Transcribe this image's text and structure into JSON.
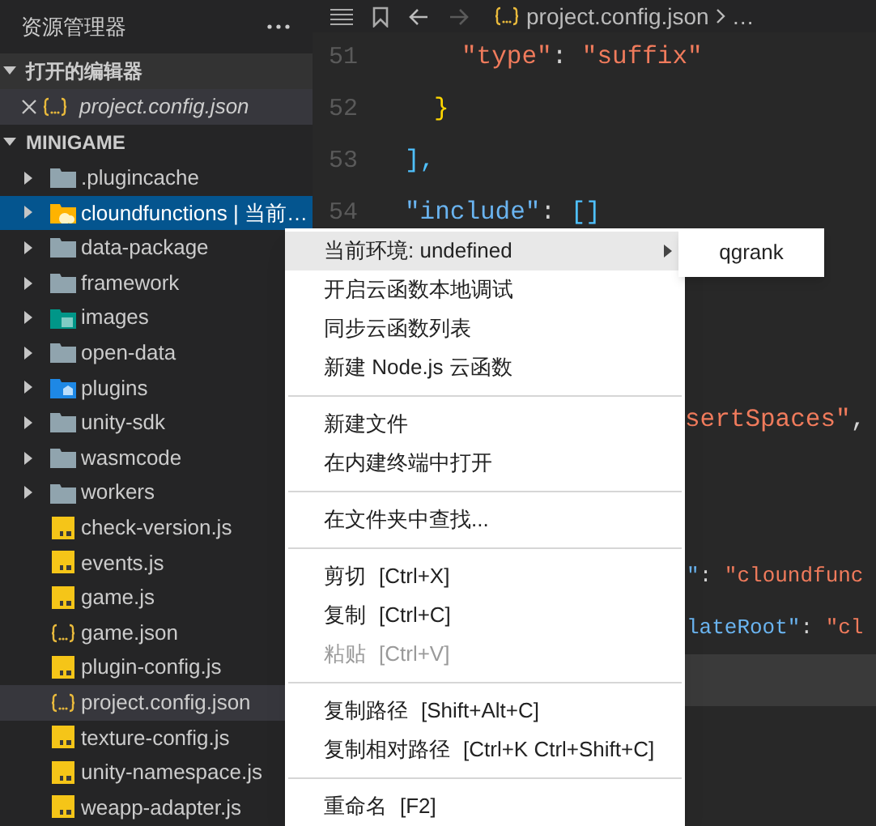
{
  "sidebar": {
    "title": "资源管理器",
    "open_editors": {
      "title": "打开的编辑器",
      "expanded": true,
      "items": [
        {
          "name": "project.config.json",
          "kind": "json",
          "active": true
        }
      ]
    },
    "project": {
      "title": "MINIGAME",
      "expanded": true,
      "items": [
        {
          "name": ".plugincache",
          "kind": "folder",
          "selected": false,
          "active": false
        },
        {
          "name": "cloundfunctions | 当前…",
          "kind": "folder-cloud",
          "selected": true,
          "active": false
        },
        {
          "name": "data-package",
          "kind": "folder",
          "selected": false,
          "active": false
        },
        {
          "name": "framework",
          "kind": "folder",
          "selected": false,
          "active": false
        },
        {
          "name": "images",
          "kind": "folder-images",
          "selected": false,
          "active": false
        },
        {
          "name": "open-data",
          "kind": "folder",
          "selected": false,
          "active": false
        },
        {
          "name": "plugins",
          "kind": "folder-plugin",
          "selected": false,
          "active": false
        },
        {
          "name": "unity-sdk",
          "kind": "folder",
          "selected": false,
          "active": false
        },
        {
          "name": "wasmcode",
          "kind": "folder",
          "selected": false,
          "active": false
        },
        {
          "name": "workers",
          "kind": "folder",
          "selected": false,
          "active": false
        },
        {
          "name": "check-version.js",
          "kind": "js",
          "selected": false,
          "active": false
        },
        {
          "name": "events.js",
          "kind": "js",
          "selected": false,
          "active": false
        },
        {
          "name": "game.js",
          "kind": "js",
          "selected": false,
          "active": false
        },
        {
          "name": "game.json",
          "kind": "json",
          "selected": false,
          "active": false
        },
        {
          "name": "plugin-config.js",
          "kind": "js",
          "selected": false,
          "active": false
        },
        {
          "name": "project.config.json",
          "kind": "json",
          "selected": false,
          "active": true
        },
        {
          "name": "texture-config.js",
          "kind": "js",
          "selected": false,
          "active": false
        },
        {
          "name": "unity-namespace.js",
          "kind": "js",
          "selected": false,
          "active": false
        },
        {
          "name": "weapp-adapter.js",
          "kind": "js",
          "selected": false,
          "active": false
        }
      ]
    }
  },
  "editor": {
    "breadcrumb": [
      "project.config.json",
      "…"
    ],
    "lines": [
      {
        "number": "51",
        "current": false,
        "tokens": [
          {
            "kind": "string",
            "text": "\"type\""
          },
          {
            "kind": "punct",
            "text": ": "
          },
          {
            "kind": "string",
            "text": "\"suffix\""
          }
        ]
      },
      {
        "number": "52",
        "current": false,
        "tokens": [
          {
            "kind": "brace",
            "text": "}"
          }
        ]
      },
      {
        "number": "53",
        "current": false,
        "tokens": [
          {
            "kind": "bracket",
            "text": "],"
          }
        ]
      },
      {
        "number": "54",
        "current": false,
        "tokens": [
          {
            "kind": "key",
            "text": "\"include\""
          },
          {
            "kind": "punct",
            "text": ": "
          },
          {
            "kind": "bracket",
            "text": "[]"
          }
        ]
      },
      {
        "current": false
      },
      {
        "current": false
      },
      {
        "current": false
      },
      {
        "current": false,
        "tokens": [
          {
            "kind": "string",
            "text": "sertSpaces\""
          },
          {
            "kind": "punct",
            "text": ","
          }
        ]
      },
      {
        "current": false
      },
      {
        "current": false
      },
      {
        "current": false,
        "tokens": [
          {
            "kind": "key",
            "text": "\""
          },
          {
            "kind": "punct",
            "text": ": "
          },
          {
            "kind": "string",
            "text": "\"cloundfunc"
          }
        ]
      },
      {
        "current": false,
        "tokens": [
          {
            "kind": "key",
            "text": "lateRoot\""
          },
          {
            "kind": "punct",
            "text": ": "
          },
          {
            "kind": "string",
            "text": "\"cl"
          }
        ]
      },
      {
        "current": true
      }
    ]
  },
  "context_menu": {
    "items": [
      {
        "kind": "item",
        "label": "当前环境: undefined",
        "highlighted": true,
        "disabled": false,
        "submenu": true
      },
      {
        "kind": "item",
        "label": "开启云函数本地调试",
        "highlighted": false,
        "disabled": false,
        "submenu": false
      },
      {
        "kind": "item",
        "label": "同步云函数列表",
        "highlighted": false,
        "disabled": false,
        "submenu": false
      },
      {
        "kind": "item",
        "label": "新建 Node.js 云函数",
        "highlighted": false,
        "disabled": false,
        "submenu": false
      },
      {
        "kind": "separator"
      },
      {
        "kind": "item",
        "label": "新建文件",
        "highlighted": false,
        "disabled": false,
        "submenu": false
      },
      {
        "kind": "item",
        "label": "在内建终端中打开",
        "highlighted": false,
        "disabled": false,
        "submenu": false
      },
      {
        "kind": "separator"
      },
      {
        "kind": "item",
        "label": "在文件夹中查找...",
        "highlighted": false,
        "disabled": false,
        "submenu": false
      },
      {
        "kind": "separator"
      },
      {
        "kind": "item",
        "label": "剪切",
        "shortcut": "[Ctrl+X]",
        "highlighted": false,
        "disabled": false,
        "submenu": false
      },
      {
        "kind": "item",
        "label": "复制",
        "shortcut": "[Ctrl+C]",
        "highlighted": false,
        "disabled": false,
        "submenu": false
      },
      {
        "kind": "item",
        "label": "粘贴",
        "shortcut": "[Ctrl+V]",
        "highlighted": false,
        "disabled": true,
        "submenu": false
      },
      {
        "kind": "separator"
      },
      {
        "kind": "item",
        "label": "复制路径",
        "shortcut": "[Shift+Alt+C]",
        "highlighted": false,
        "disabled": false,
        "submenu": false
      },
      {
        "kind": "item",
        "label": "复制相对路径",
        "shortcut": "[Ctrl+K Ctrl+Shift+C]",
        "highlighted": false,
        "disabled": false,
        "submenu": false
      },
      {
        "kind": "separator"
      },
      {
        "kind": "item",
        "label": "重命名",
        "shortcut": "[F2]",
        "highlighted": false,
        "disabled": false,
        "submenu": false
      }
    ],
    "submenu": {
      "items": [
        "qgrank"
      ]
    }
  }
}
